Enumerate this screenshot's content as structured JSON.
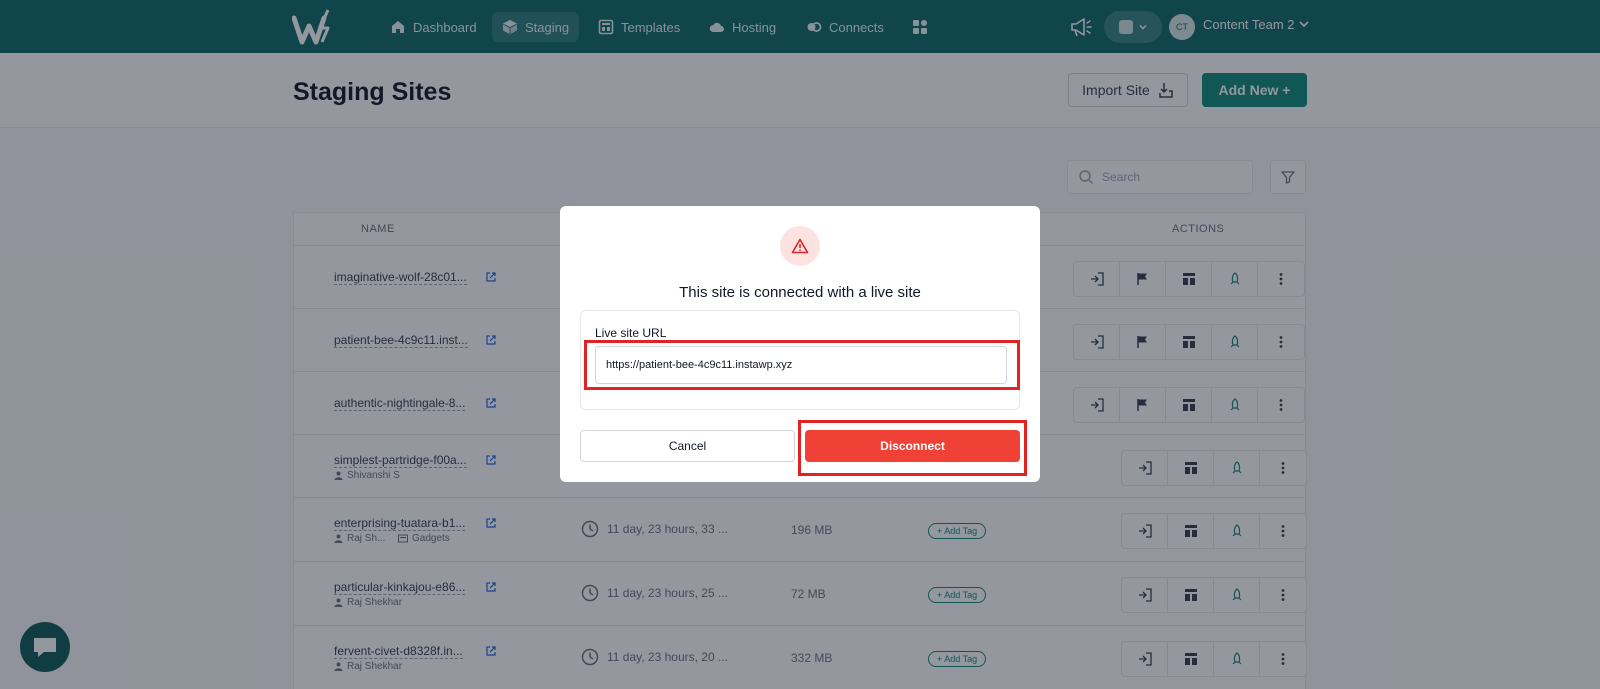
{
  "nav": {
    "items": [
      {
        "label": "Dashboard",
        "icon": "home-icon"
      },
      {
        "label": "Staging",
        "icon": "cube-icon"
      },
      {
        "label": "Templates",
        "icon": "template-icon"
      },
      {
        "label": "Hosting",
        "icon": "cloud-icon"
      },
      {
        "label": "Connects",
        "icon": "link-icon"
      }
    ],
    "active": "Staging",
    "team_avatar": "CT",
    "team_name": "Content Team 2"
  },
  "header": {
    "title": "Staging Sites",
    "import_label": "Import Site",
    "add_label": "Add New +"
  },
  "search": {
    "placeholder": "Search"
  },
  "table": {
    "col_name": "NAME",
    "col_actions": "ACTIONS",
    "rows": [
      {
        "site": "imaginative-wolf-28c01...",
        "owner": "",
        "tag": "",
        "time": "",
        "size": "",
        "add_tag": ""
      },
      {
        "site": "patient-bee-4c9c11.inst...",
        "owner": "",
        "tag": "",
        "time": "",
        "size": "",
        "add_tag": ""
      },
      {
        "site": "authentic-nightingale-8...",
        "owner": "",
        "tag": "",
        "time": "",
        "size": "",
        "add_tag": ""
      },
      {
        "site": "simplest-partridge-f00a...",
        "owner": "Shivanshi S",
        "tag": "",
        "time": "",
        "size": "",
        "add_tag": ""
      },
      {
        "site": "enterprising-tuatara-b1...",
        "owner": "Raj Sh...",
        "tag": "Gadgets",
        "time": "11 day, 23 hours, 33 ...",
        "size": "196 MB",
        "add_tag": "+ Add Tag"
      },
      {
        "site": "particular-kinkajou-e86...",
        "owner": "Raj Shekhar",
        "tag": "",
        "time": "11 day, 23 hours, 25 ...",
        "size": "72 MB",
        "add_tag": "+ Add Tag"
      },
      {
        "site": "fervent-civet-d8328f.in...",
        "owner": "Raj Shekhar",
        "tag": "",
        "time": "11 day, 23 hours, 20 ...",
        "size": "332 MB",
        "add_tag": "+ Add Tag"
      }
    ]
  },
  "modal": {
    "title": "This site is connected with a live site",
    "url_label": "Live site URL",
    "url_value": "https://patient-bee-4c9c11.instawp.xyz",
    "cancel_label": "Cancel",
    "disconnect_label": "Disconnect"
  },
  "colors": {
    "nav_bg": "#0f6b6b",
    "accent": "#0f8a7a",
    "danger": "#ef4135",
    "highlight": "#e02424"
  }
}
